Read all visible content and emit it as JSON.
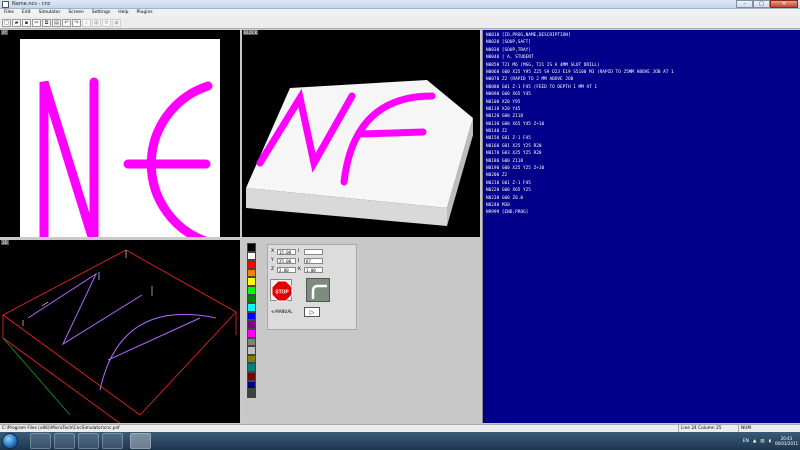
{
  "window": {
    "title": "Name.ncs - cnc",
    "min_label": "–",
    "max_label": "□",
    "close_label": "✕"
  },
  "menu": [
    "Files",
    "Edit",
    "Simulator",
    "Screen",
    "Settings",
    "Help",
    "Plugins"
  ],
  "panes": {
    "top_left_label": "XY",
    "top_right_label": "BLOCK",
    "bottom_left_label": "3D",
    "plot_letters": "NE"
  },
  "code_lines": [
    "N0010 [ID,PROG,NAME,DESCRIPTION]",
    "N0020 [SOUP,SAFT]",
    "N0030 [SOUP,TRAY]",
    "N0040 [ A, STUDENT",
    "N0050 T21 M6 (MSG, T21 IS A 4MM SLOT DRILL)",
    "N0060 G00 X25 Y95 Z25 S9 D23 E19 S5100 M3 (RAPID TO 25MM ABOVE JOB AT 1",
    "N0070 Z2 (RAPID TO 2 MM ABOVE JOB",
    "N0080 G01 Z-1 F45 (FEED TO DEPTH 1 MM AT 1",
    "N0090 G00 X65 Y45",
    "N0100 X20 Y95",
    "N0110 X20 Y45",
    "N0120 G00 Z118",
    "N0130 G00 X65 Y45 Z+10",
    "N0140 Z2",
    "N0150 G01 Z-1 F45",
    "N0160 G01 X25 Y25 R20",
    "N0170 G03 X25 Y25 R20",
    "N0180 G00 Z118",
    "N0190 G00 X25 Y25 Z+10",
    "N0200 Z2",
    "N0210 G01 Z-1 F45",
    "N0220 G00 X65 Y25",
    "N0230 G00 Z0.0",
    "N0240 M30",
    "N9999 [END,PROG]"
  ],
  "coordinates": {
    "x": {
      "label": "X",
      "value": "15.00",
      "side_label": "I",
      "side_value": ""
    },
    "y": {
      "label": "Y",
      "value": "25.00",
      "side_label": "J",
      "side_value": "87"
    },
    "z": {
      "label": "Z",
      "value": "2.00",
      "side_label": "K",
      "side_value": "1.00"
    }
  },
  "controls": {
    "stop_label": "STOP",
    "manual_label": "MANUAL",
    "play_symbol": "▷"
  },
  "palette_colors": [
    "#000000",
    "#ffffff",
    "#ff0000",
    "#ff8000",
    "#ffff00",
    "#00ff00",
    "#008000",
    "#00ffff",
    "#0000ff",
    "#800080",
    "#ff00ff",
    "#808080",
    "#c0c0c0",
    "#808000",
    "#008080",
    "#800000",
    "#000080",
    "#404040"
  ],
  "status": {
    "path": "C:\\Program Files (x86)\\MicroTech\\CncSimulator\\cnc.pnf",
    "position": "Line 24 Column 25",
    "mode": "NUM"
  },
  "taskbar": {
    "lang": "EN",
    "time": "20:43",
    "date": "06/03/2011"
  },
  "colors": {
    "accent_magenta": "#ff00ff",
    "editor_bg": "#00008b"
  }
}
